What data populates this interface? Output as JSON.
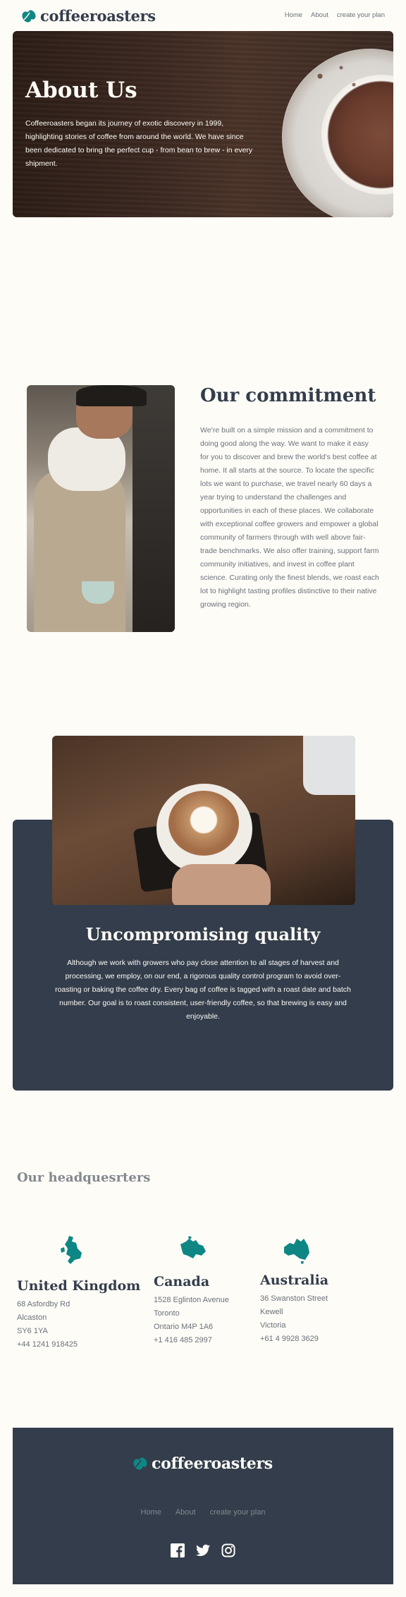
{
  "header": {
    "logo_text": "coffeeroasters",
    "nav": [
      "Home",
      "About",
      "create your plan"
    ]
  },
  "hero": {
    "title": "About Us",
    "text": "Coffeeroasters began its journey of exotic discovery in 1999, highlighting stories of coffee from around the world. We have since been dedicated to bring the perfect cup - from bean to brew - in every shipment."
  },
  "commitment": {
    "title": "Our commitment",
    "text": "We’re built on a simple mission and a commitment to doing good along the way. We want to make it easy for you to discover and brew the world’s best coffee at home. It all starts at the source. To locate the specific lots we want to purchase, we travel nearly 60 days a year trying to understand the challenges and opportunities in each of these places. We collaborate with exceptional coffee growers and empower a global community of farmers through with well above fair-trade benchmarks. We also offer training, support farm community initiatives, and invest in coffee plant science. Curating only the finest blends, we roast each lot to highlight tasting profiles distinctive to their native growing region."
  },
  "quality": {
    "title": "Uncompromising quality",
    "text": "Although we work with growers who pay close attention to all stages of harvest and processing, we employ, on our end, a rigorous quality control program to avoid over-roasting or baking the coffee dry. Every bag of coffee is tagged with a roast date and batch number. Our goal is to roast consistent, user-friendly coffee, so that brewing is easy and enjoyable."
  },
  "headquarters": {
    "title": "Our headquesrters",
    "locations": [
      {
        "country": "United Kingdom",
        "lines": [
          "68 Asfordby Rd",
          "Alcaston",
          "SY6 1YA",
          "+44 1241 918425"
        ]
      },
      {
        "country": "Canada",
        "lines": [
          "1528 Eglinton Avenue",
          "Toronto",
          "Ontario M4P 1A6",
          "+1 416 485 2997"
        ]
      },
      {
        "country": "Australia",
        "lines": [
          "36 Swanston Street",
          "Kewell",
          "Victoria",
          "+61 4 9928 3629"
        ]
      }
    ]
  },
  "footer": {
    "logo_text": "coffeeroasters",
    "nav": [
      "Home",
      "About",
      "create your plan"
    ],
    "social_icons": [
      "facebook-icon",
      "twitter-icon",
      "instagram-icon"
    ]
  },
  "colors": {
    "dark_navy": "#333d4b",
    "teal": "#0e8784",
    "cream": "#fefcf7",
    "grey": "#83888f"
  }
}
